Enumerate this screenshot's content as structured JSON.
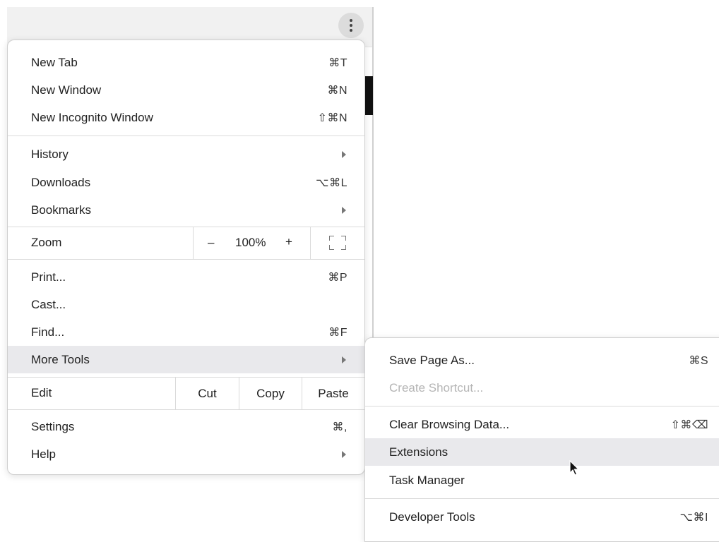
{
  "menu": {
    "group1": [
      {
        "label": "New Tab",
        "shortcut": "⌘T"
      },
      {
        "label": "New Window",
        "shortcut": "⌘N"
      },
      {
        "label": "New Incognito Window",
        "shortcut": "⇧⌘N"
      }
    ],
    "group2": [
      {
        "label": "History",
        "shortcut": ""
      },
      {
        "label": "Downloads",
        "shortcut": "⌥⌘L"
      },
      {
        "label": "Bookmarks",
        "shortcut": ""
      }
    ],
    "zoom": {
      "label": "Zoom",
      "minus": "–",
      "value": "100%",
      "plus": "+"
    },
    "group3": [
      {
        "label": "Print...",
        "shortcut": "⌘P"
      },
      {
        "label": "Cast...",
        "shortcut": ""
      },
      {
        "label": "Find...",
        "shortcut": "⌘F"
      },
      {
        "label": "More Tools",
        "shortcut": ""
      }
    ],
    "edit": {
      "label": "Edit",
      "cut": "Cut",
      "copy": "Copy",
      "paste": "Paste"
    },
    "group4": [
      {
        "label": "Settings",
        "shortcut": "⌘,"
      },
      {
        "label": "Help",
        "shortcut": ""
      }
    ]
  },
  "submenu": {
    "items": [
      {
        "label": "Save Page As...",
        "shortcut": "⌘S"
      },
      {
        "label": "Create Shortcut...",
        "shortcut": ""
      },
      {
        "label": "Clear Browsing Data...",
        "shortcut": "⇧⌘⌫"
      },
      {
        "label": "Extensions",
        "shortcut": ""
      },
      {
        "label": "Task Manager",
        "shortcut": ""
      },
      {
        "label": "Developer Tools",
        "shortcut": "⌥⌘I"
      }
    ]
  },
  "colors": {
    "highlight": "#e9e9ec",
    "disabled": "#b5b5b5"
  }
}
